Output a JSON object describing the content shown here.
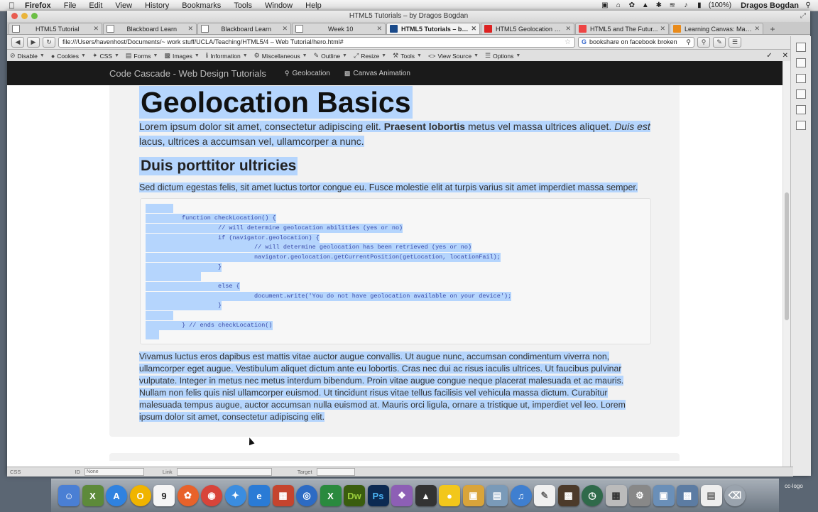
{
  "menubar": {
    "app": "Firefox",
    "items": [
      "File",
      "Edit",
      "View",
      "History",
      "Bookmarks",
      "Tools",
      "Window",
      "Help"
    ],
    "battery": "(100%)",
    "user": "Dragos Bogdan"
  },
  "window": {
    "title": "HTML5 Tutorials – by Dragos Bogdan"
  },
  "tabs": [
    {
      "label": "HTML5 Tutorial",
      "favicon": "page-icon"
    },
    {
      "label": "Blackboard Learn",
      "favicon": "page-icon"
    },
    {
      "label": "Blackboard Learn",
      "favicon": "page-icon"
    },
    {
      "label": "Week 10",
      "favicon": "page-icon"
    },
    {
      "label": "HTML5 Tutorials – by ...",
      "favicon": "bootstrap-icon",
      "active": true
    },
    {
      "label": "HTML5 Geolocation Ba...",
      "favicon": "youtube-icon"
    },
    {
      "label": "HTML5 and The Futur...",
      "favicon": "gmail-icon"
    },
    {
      "label": "Learning Canvas: Maki...",
      "favicon": "canvas-icon"
    }
  ],
  "navbar": {
    "url": "file:///Users/havenhost/Documents/~ work stuff/UCLA/Teaching/HTML5/4 – Web Tutorial/hero.html#",
    "search": "bookshare on facebook broken"
  },
  "devbar": {
    "items": [
      "Disable",
      "Cookies",
      "CSS",
      "Forms",
      "Images",
      "Information",
      "Miscellaneous",
      "Outline",
      "Resize",
      "Tools",
      "View Source",
      "Options"
    ]
  },
  "site": {
    "brand": "Code Cascade - Web Design Tutorials",
    "nav": [
      "Geolocation",
      "Canvas Animation"
    ]
  },
  "article": {
    "title": "Geolocation Basics",
    "lead_1": "Lorem ipsum dolor sit amet, consectetur adipiscing elit.",
    "lead_bold": "Praesent lobortis",
    "lead_2": "metus vel massa ultrices aliquet.",
    "lead_em": "Duis est",
    "lead_3": "lacus, ultrices a accumsan vel, ullamcorper a nunc.",
    "subtitle": "Duis porttitor ultricies",
    "sub_text": "Sed dictum egestas felis, sit amet luctus tortor congue eu. Fusce molestie elit at turpis varius sit amet imperdiet massa semper.",
    "code": [
      "          function checkLocation() {",
      "                    // will determine geolocation abilities (yes or no)",
      "                    if (navigator.geolocation) {",
      "                              // will determine geolocation has been retrieved (yes or no)",
      "                              navigator.geolocation.getCurrentPosition(getLocation, locationFail);",
      "                    }",
      "                    else {",
      "                              document.write('You do not have geolocation available on your device');",
      "                    }",
      "          } // ends checkLocation()"
    ],
    "body": "Vivamus luctus eros dapibus est mattis vitae auctor augue convallis. Ut augue nunc, accumsan condimentum viverra non, ullamcorper eget augue. Vestibulum aliquet dictum ante eu lobortis. Cras nec dui ac risus iaculis ultrices. Ut faucibus pulvinar vulputate. Integer in metus nec metus interdum bibendum. Proin vitae augue congue neque placerat malesuada et ac mauris. Nullam non felis quis nisl ullamcorper euismod. Ut tincidunt risus vitae tellus facilisis vel vehicula massa dictum. Curabitur malesuada tempus augue, auctor accumsan nulla euismod at. Mauris orci ligula, ornare a tristique ut, imperdiet vel leo. Lorem ipsum dolor sit amet, consectetur adipiscing elit."
  },
  "statusbar": {
    "css": "CSS",
    "id_label": "ID",
    "id_value": "None",
    "link_label": "Link",
    "target_label": "Target"
  },
  "dock": {
    "icons": [
      "finder-icon",
      "x-icon",
      "app-store-icon",
      "o-icon",
      "calendar-icon",
      "firefox-icon",
      "chrome-icon",
      "safari-icon",
      "ie-icon",
      "photo-icon",
      "earth-icon",
      "excel-icon",
      "dreamweaver-icon",
      "photoshop-icon",
      "purple-icon",
      "black-icon",
      "duck-icon",
      "truck-icon",
      "screen-icon",
      "itunes-icon",
      "pages-icon",
      "photo2-icon",
      "time-machine-icon",
      "calculator-icon",
      "settings-icon",
      "preview-icon",
      "system-icon",
      "document-icon",
      "trash-icon"
    ],
    "calendar_day": "9",
    "dw": "Dw",
    "ps": "Ps"
  },
  "watermark": "cc-logo",
  "colors": {
    "selection": "#b5d5fd",
    "site_nav": "#1a1a1a",
    "article_bg": "#f2f2f2"
  }
}
